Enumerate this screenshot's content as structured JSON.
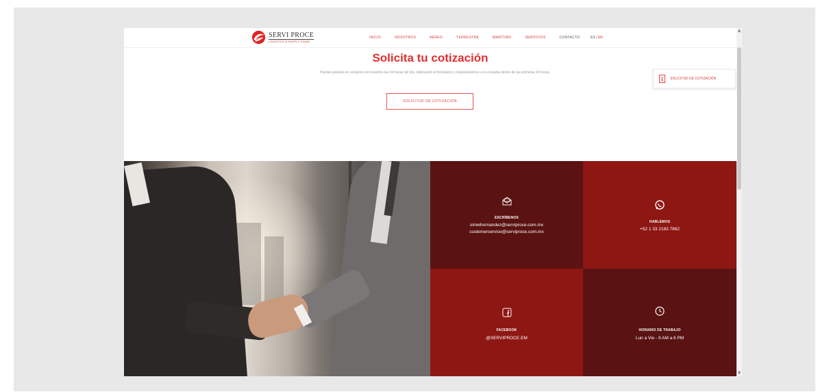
{
  "header": {
    "logo_name": "SERVI PROCE",
    "logo_tagline": "LOGISTICS & SUPPLY CHAIN",
    "nav": [
      "INICIO",
      "NOSOTROS",
      "AÉREO",
      "TERRESTRE",
      "MARÍTIMO",
      "SERVICIOS",
      "CONTACTO"
    ],
    "lang_es": "ES",
    "lang_sep": "/",
    "lang_en": "EN"
  },
  "hero": {
    "title": "Solicita tu cotización",
    "text": "Puedes ponerte en contacto con nosotros las 24 horas del día, rellenando el formulario y responderemos a tu consulta dentro de las primeras 24 horas.",
    "button": "SOLICITUD DE COTIZACIÓN"
  },
  "side_tab": {
    "label": "SOLICITUD DE COTIZACIÓN",
    "icon": "document-icon"
  },
  "contact": {
    "email": {
      "icon": "envelope-icon",
      "title": "ESCRÍBENOS",
      "line1": "simeihornandez@serviproce.com.mx",
      "line2": "custemerservice@serviproce.com.mx"
    },
    "whatsapp": {
      "icon": "whatsapp-icon",
      "title": "HABLEMOS",
      "line1": "+52 1 33 2183 7862"
    },
    "facebook": {
      "icon": "facebook-icon",
      "title": "FACEBOOK",
      "line1": "@SERVIPROCE.EM"
    },
    "hours": {
      "icon": "clock-icon",
      "title": "HORARIO DE TRABAJO",
      "line1": "Lun a Vie - 9 AM a 6 PM"
    }
  },
  "colors": {
    "accent": "#e03030",
    "tile_dark": "#5a1312",
    "tile_red": "#8e1713",
    "frame": "#e8e8e9"
  }
}
